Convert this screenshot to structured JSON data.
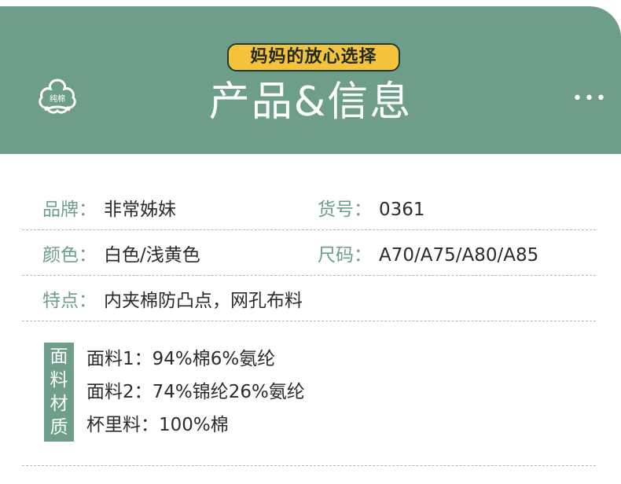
{
  "header": {
    "logo_text": "纯棉",
    "badge": "妈妈的放心选择",
    "title": "产品&信息"
  },
  "info": {
    "brand_label": "品牌：",
    "brand_value": "非常姊妹",
    "sku_label": "货号：",
    "sku_value": "0361",
    "color_label": "颜色：",
    "color_value": "白色/浅黄色",
    "size_label": "尺码：",
    "size_value": "A70/A75/A80/A85",
    "feature_label": "特点：",
    "feature_value": "内夹棉防凸点，网孔布料"
  },
  "material": {
    "tag": [
      "面",
      "料",
      "材",
      "质"
    ],
    "lines": [
      "面料1：94%棉6%氨纶",
      "面料2：74%锦纶26%氨纶",
      "杯里料：100%棉"
    ]
  },
  "colors": {
    "accent": "#6e9e8a",
    "badge": "#f4c33b",
    "text": "#2b2b2b"
  }
}
